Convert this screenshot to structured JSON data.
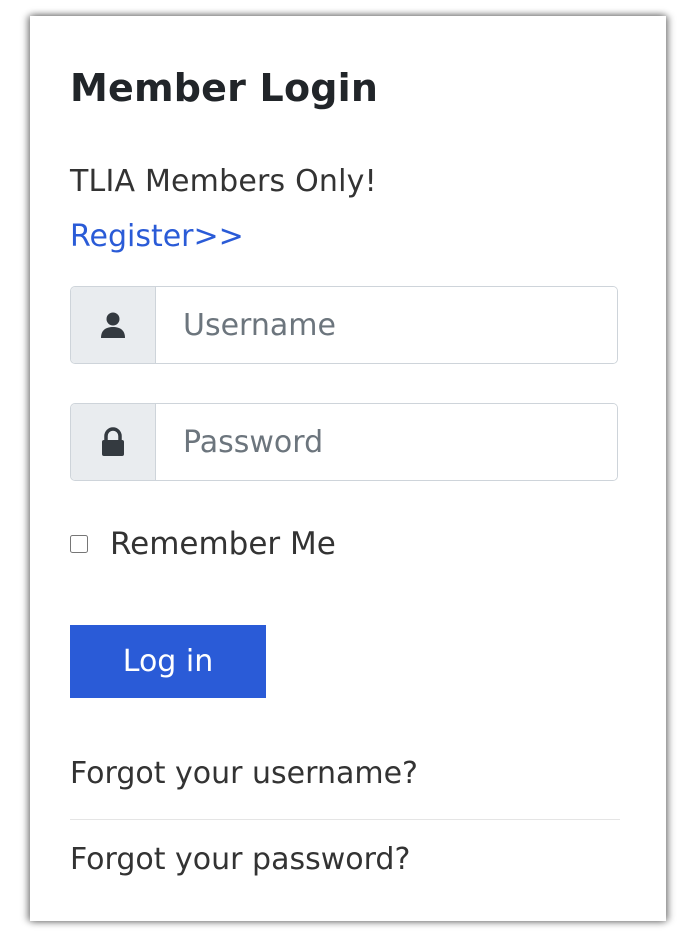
{
  "login": {
    "title": "Member Login",
    "tagline": "TLIA Members Only!",
    "register_link": "Register>>",
    "username": {
      "icon": "user-icon",
      "placeholder": "Username",
      "value": ""
    },
    "password": {
      "icon": "lock-icon",
      "placeholder": "Password",
      "value": ""
    },
    "remember_me": {
      "label": "Remember Me",
      "checked": false
    },
    "submit_label": "Log in",
    "forgot_username": "Forgot your username?",
    "forgot_password": "Forgot your password?"
  },
  "colors": {
    "accent": "#2a5bd7",
    "text": "#333333",
    "addon_bg": "#e9ecef",
    "border": "#ced4da"
  }
}
